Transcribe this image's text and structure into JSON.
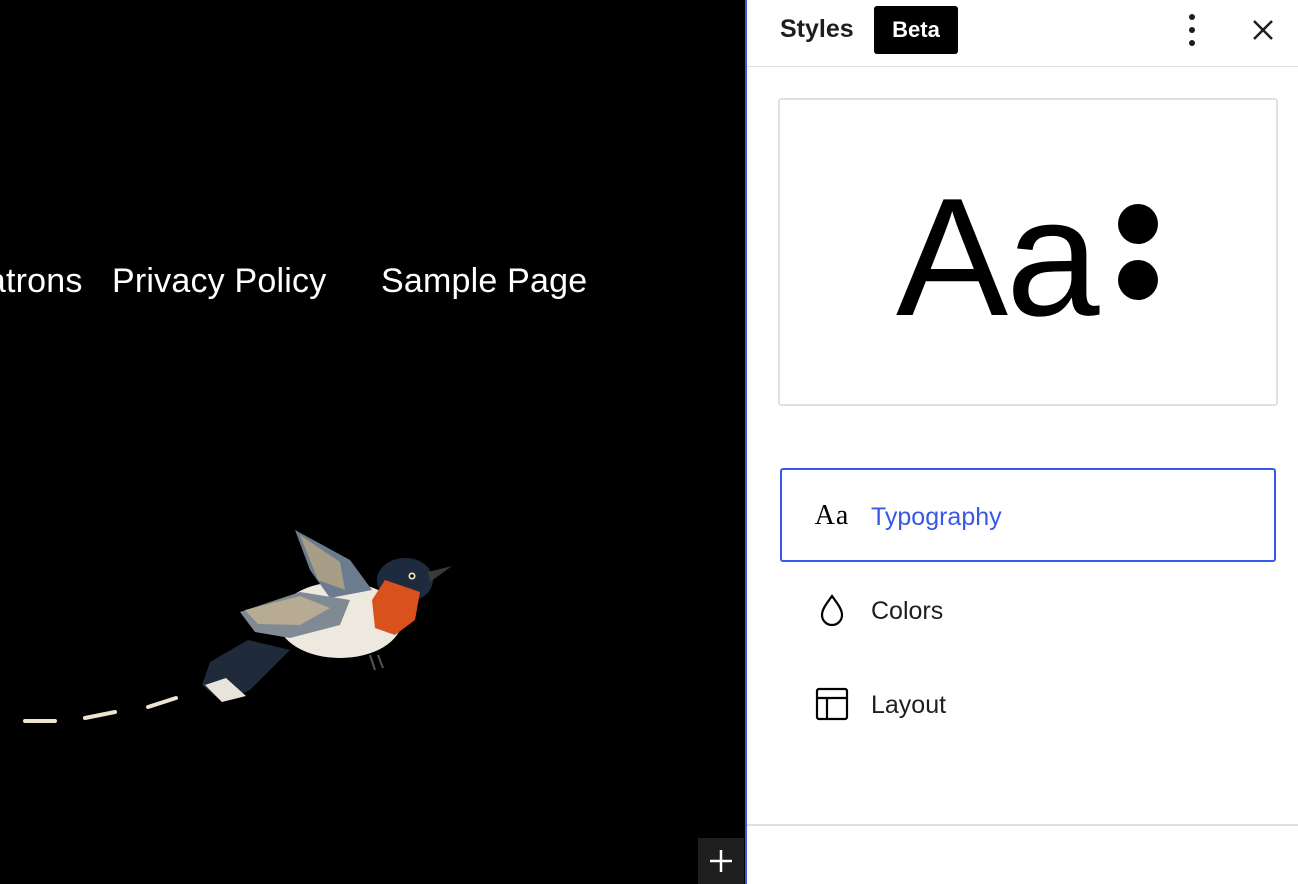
{
  "canvas": {
    "nav_links": [
      "Patrons",
      "Privacy Policy",
      "Sample Page"
    ],
    "add_block_icon": "plus-icon"
  },
  "sidebar": {
    "title": "Styles",
    "badge": "Beta",
    "more_icon": "vertical-ellipsis-icon",
    "close_icon": "close-icon",
    "preview": {
      "sample_text": "Aa"
    },
    "menu": [
      {
        "label": "Typography",
        "icon": "typography-icon",
        "active": true
      },
      {
        "label": "Colors",
        "icon": "droplet-icon",
        "active": false
      },
      {
        "label": "Layout",
        "icon": "layout-icon",
        "active": false
      }
    ]
  },
  "colors": {
    "accent": "#3858e9",
    "canvas_bg": "#000000"
  }
}
